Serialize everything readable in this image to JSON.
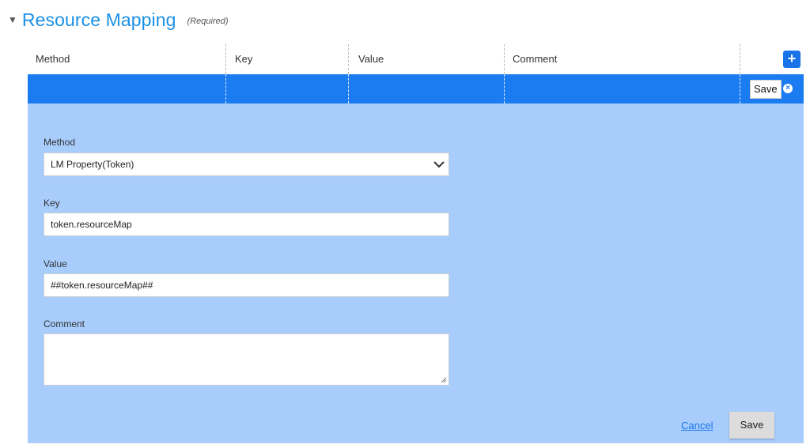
{
  "section": {
    "title": "Resource Mapping",
    "required_note": "(Required)",
    "collapse_glyph": "▼"
  },
  "table": {
    "columns": [
      "Method",
      "Key",
      "Value",
      "Comment"
    ],
    "add_button_glyph": "+",
    "row_save_label": "Save",
    "row_close_glyph": "×"
  },
  "form": {
    "method_label": "Method",
    "method_value": "LM Property(Token)",
    "key_label": "Key",
    "key_value": "token.resourceMap",
    "value_label": "Value",
    "value_value": "##token.resourceMap##",
    "comment_label": "Comment",
    "comment_value": "",
    "cancel_label": "Cancel",
    "save_label": "Save"
  },
  "colors": {
    "accent": "#1a7cf0",
    "panel": "#a8cdfd",
    "title": "#1a90e6"
  }
}
